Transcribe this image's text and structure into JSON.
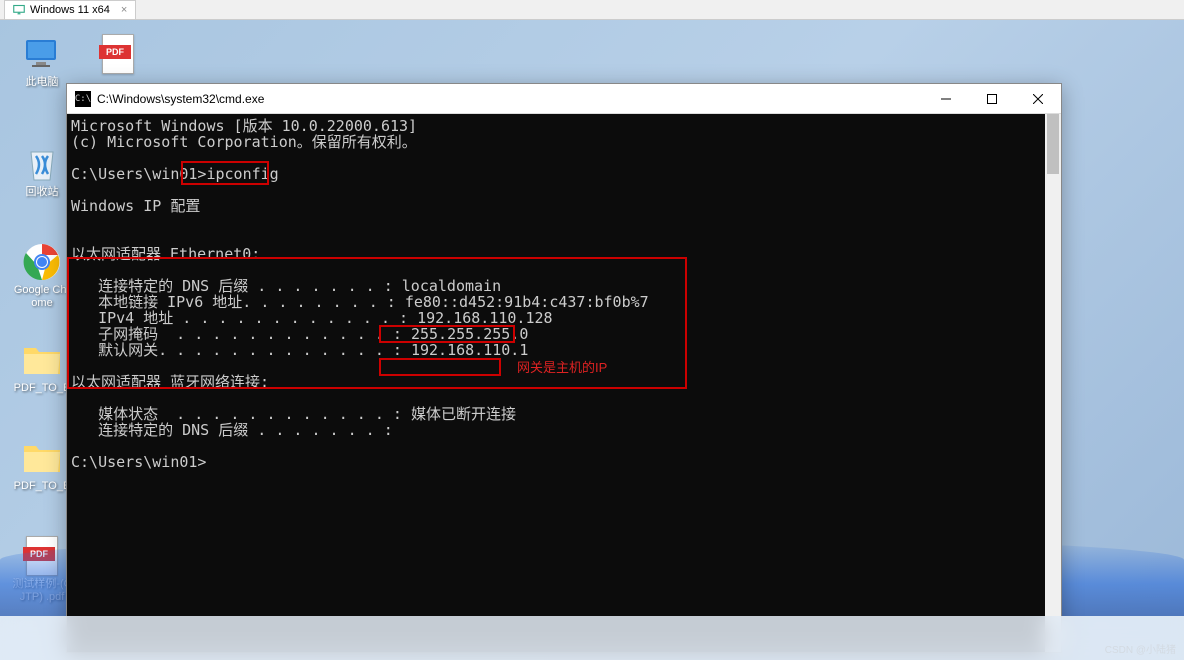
{
  "vm_tab": {
    "label": "Windows 11 x64"
  },
  "desktop_icons": {
    "this_pc": "此电脑",
    "recycle_bin": "回收站",
    "chrome": "Google Chrome",
    "folder1": "PDF_TO_E",
    "folder2": "PDF_TO_E",
    "pdf_test": "测试样例-(CJTP) .pdf",
    "pdf_top": "PDF"
  },
  "cmd": {
    "title": "C:\\Windows\\system32\\cmd.exe",
    "line1": "Microsoft Windows [版本 10.0.22000.613]",
    "line2": "(c) Microsoft Corporation。保留所有权利。",
    "prompt1": "C:\\Users\\win01>",
    "command": "ipconfig",
    "heading": "Windows IP 配置",
    "adapter1": "以太网适配器 Ethernet0:",
    "dns_suffix_label": "   连接特定的 DNS 后缀 . . . . . . . :",
    "dns_suffix_value": " localdomain",
    "ipv6_label": "   本地链接 IPv6 地址. . . . . . . . :",
    "ipv6_value": " fe80::d452:91b4:c437:bf0b%7",
    "ipv4_label": "   IPv4 地址 . . . . . . . . . . . . :",
    "ipv4_value": " 192.168.110.128",
    "subnet_label": "   子网掩码  . . . . . . . . . . . . :",
    "subnet_value": " 255.255.255.0",
    "gateway_label": "   默认网关. . . . . . . . . . . . . :",
    "gateway_value": " 192.168.110.1",
    "adapter2": "以太网适配器 蓝牙网络连接:",
    "media_label": "   媒体状态  . . . . . . . . . . . . :",
    "media_value": " 媒体已断开连接",
    "dns2_label": "   连接特定的 DNS 后缀 . . . . . . . :",
    "prompt2": "C:\\Users\\win01>"
  },
  "annotation": "网关是主机的IP",
  "watermark": "CSDN @小陆猪"
}
